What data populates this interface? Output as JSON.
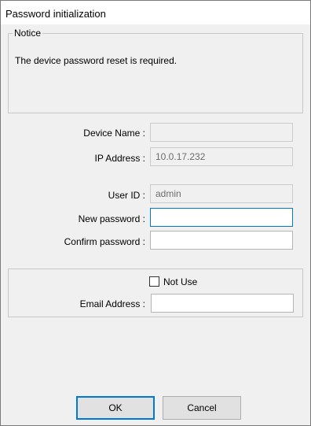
{
  "window": {
    "title": "Password initialization"
  },
  "notice": {
    "legend": "Notice",
    "message": "The device password reset is required."
  },
  "device": {
    "name_label": "Device Name :",
    "name_value": "",
    "ip_label": "IP Address :",
    "ip_value": "10.0.17.232"
  },
  "credentials": {
    "user_label": "User ID :",
    "user_value": "admin",
    "new_password_label": "New password :",
    "new_password_value": "",
    "confirm_password_label": "Confirm password :",
    "confirm_password_value": ""
  },
  "email": {
    "not_use_label": "Not Use",
    "not_use_checked": false,
    "address_label": "Email Address :",
    "address_value": ""
  },
  "buttons": {
    "ok": "OK",
    "cancel": "Cancel"
  }
}
